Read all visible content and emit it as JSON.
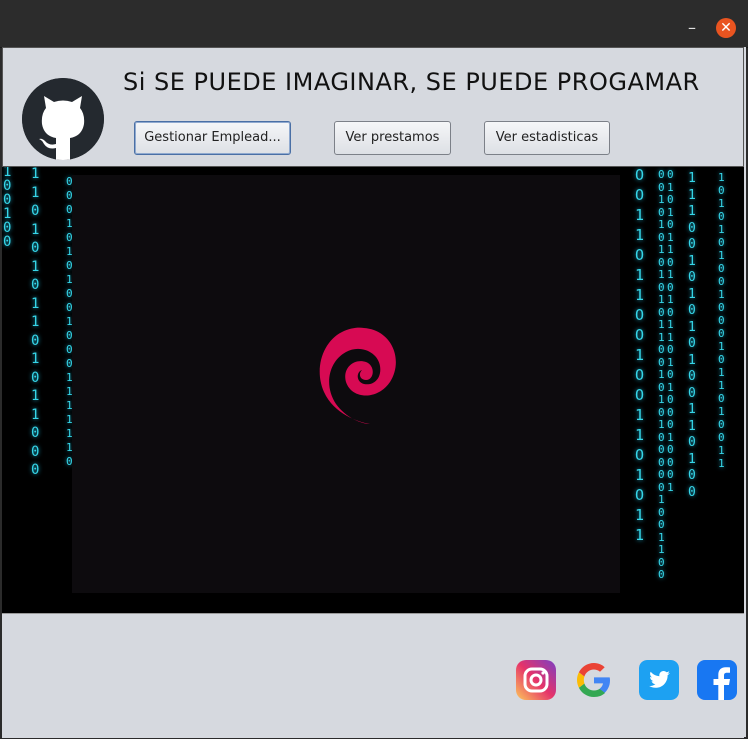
{
  "window": {
    "minimize_glyph": "–",
    "close_glyph": "✕"
  },
  "header": {
    "headline": "Si SE PUEDE IMAGINAR, SE PUEDE PROGAMAR",
    "logo_icon": "github-icon",
    "buttons": {
      "employees": "Gestionar Emplead...",
      "loans": "Ver prestamos",
      "stats": "Ver estadisticas"
    }
  },
  "main": {
    "background": "binary-matrix-rain",
    "center_logo": "debian-swirl-icon",
    "accent_color": "#d70a53",
    "matrix_color": "#36d6e8"
  },
  "footer": {
    "social_icons": [
      "instagram-icon",
      "google-icon",
      "twitter-icon",
      "facebook-icon"
    ]
  }
}
